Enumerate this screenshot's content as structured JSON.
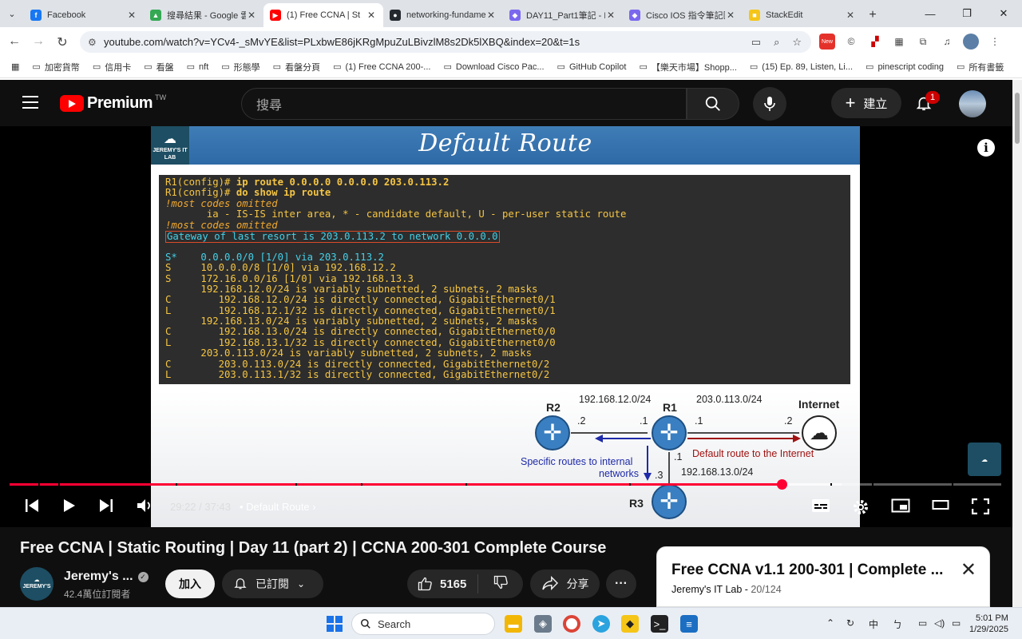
{
  "browser": {
    "tabs": [
      {
        "title": "Facebook",
        "color": "#1877f2",
        "glyph": "f"
      },
      {
        "title": "搜尋結果 - Google 雲端",
        "color": "#34a853",
        "glyph": "▲"
      },
      {
        "title": "(1) Free CCNA | St",
        "color": "#ff0000",
        "glyph": "▶",
        "active": true
      },
      {
        "title": "networking-fundame",
        "color": "#24292f",
        "glyph": "●"
      },
      {
        "title": "DAY11_Part1筆記 - H",
        "color": "#7b68ee",
        "glyph": "◆"
      },
      {
        "title": "Cisco IOS 指令筆記區",
        "color": "#7b68ee",
        "glyph": "◆"
      },
      {
        "title": "StackEdit",
        "color": "#f5c518",
        "glyph": "■"
      }
    ],
    "url": "youtube.com/watch?v=YCv4-_sMvYE&list=PLxbwE86jKRgMpuZuLBivzlM8s2Dk5lXBQ&index=20&t=1s",
    "bookmarks": [
      "加密貨幣",
      "信用卡",
      "看盤",
      "nft",
      "形態學",
      "看盤分頁",
      "(1) Free CCNA 200-...",
      "Download Cisco Pac...",
      "GitHub Copilot",
      "【樂天市場】Shopp...",
      "(15) Ep. 89, Listen, Li...",
      "pinescript coding",
      "所有書籤"
    ]
  },
  "youtube": {
    "logo": "Premium",
    "region": "TW",
    "search_placeholder": "搜尋",
    "create_label": "建立",
    "notif_count": "1"
  },
  "slide": {
    "brand": "JEREMY'S IT LAB",
    "title": "Default Route",
    "console": [
      [
        {
          "t": "R1(config)# ",
          "c": "orange"
        },
        {
          "t": "ip route 0.0.0.0 0.0.0.0 203.0.113.2",
          "c": "orange cmd"
        }
      ],
      [
        {
          "t": "R1(config)# ",
          "c": "orange"
        },
        {
          "t": "do show ip route",
          "c": "orange cmd"
        }
      ],
      [
        {
          "t": "!most codes omitted",
          "c": "amber it"
        }
      ],
      [
        {
          "t": "       ia - IS-IS inter area, * - candidate default, U - per-user static route",
          "c": "orange"
        }
      ],
      [
        {
          "t": "!most codes omitted",
          "c": "amber it"
        }
      ],
      [
        {
          "t": "Gateway of last resort is 203.0.113.2 to network 0.0.0.0",
          "c": "cyan gateway"
        }
      ],
      [
        {
          "t": " ",
          "c": "orange"
        }
      ],
      [
        {
          "t": "S*    0.0.0.0/0 [1/0] via 203.0.113.2",
          "c": "cyan"
        }
      ],
      [
        {
          "t": "S     10.0.0.0/8 [1/0] via 192.168.12.2",
          "c": "orange"
        }
      ],
      [
        {
          "t": "S     172.16.0.0/16 [1/0] via 192.168.13.3",
          "c": "orange"
        }
      ],
      [
        {
          "t": "      192.168.12.0/24 is variably subnetted, 2 subnets, 2 masks",
          "c": "orange"
        }
      ],
      [
        {
          "t": "C        192.168.12.0/24 is directly connected, GigabitEthernet0/1",
          "c": "orange"
        }
      ],
      [
        {
          "t": "L        192.168.12.1/32 is directly connected, GigabitEthernet0/1",
          "c": "orange"
        }
      ],
      [
        {
          "t": "      192.168.13.0/24 is variably subnetted, 2 subnets, 2 masks",
          "c": "orange"
        }
      ],
      [
        {
          "t": "C        192.168.13.0/24 is directly connected, GigabitEthernet0/0",
          "c": "orange"
        }
      ],
      [
        {
          "t": "L        192.168.13.1/32 is directly connected, GigabitEthernet0/0",
          "c": "orange"
        }
      ],
      [
        {
          "t": "      203.0.113.0/24 is variably subnetted, 2 subnets, 2 masks",
          "c": "orange"
        }
      ],
      [
        {
          "t": "C        203.0.113.0/24 is directly connected, GigabitEthernet0/2",
          "c": "orange"
        }
      ],
      [
        {
          "t": "L        203.0.113.1/32 is directly connected, GigabitEthernet0/2",
          "c": "orange"
        }
      ]
    ],
    "diagram": {
      "r2": "R2",
      "r1": "R1",
      "r3": "R3",
      "internet": "Internet",
      "net12": "192.168.12.0/24",
      "net203": "203.0.113.0/24",
      "net13": "192.168.13.0/24",
      "r2_if": ".2",
      "r1_if_left": ".1",
      "r1_if_right": ".1",
      "inet_if": ".2",
      "r1_if_down": ".1",
      "r3_if": ".3",
      "specific_routes_line1": "Specific routes to internal",
      "specific_routes_line2": "networks",
      "default_route": "Default route to the Internet"
    }
  },
  "player": {
    "current_time": "29:22",
    "duration": "37:43",
    "progress": 0.7786,
    "chapter": "Default Route"
  },
  "video": {
    "title": "Free CCNA | Static Routing | Day 11 (part 2) | CCNA 200-301 Complete Course",
    "channel": "Jeremy's ...",
    "subscribers": "42.4萬位訂閱者",
    "join_label": "加入",
    "subscribed_label": "已訂閱",
    "likes": "5165",
    "share_label": "分享"
  },
  "playlist": {
    "title": "Free CCNA v1.1 200-301 | Complete ...",
    "owner": "Jeremy's IT Lab",
    "position": "20/124"
  },
  "taskbar": {
    "search_label": "Search",
    "ime": "中",
    "time": "5:01 PM",
    "date": "1/29/2025"
  }
}
